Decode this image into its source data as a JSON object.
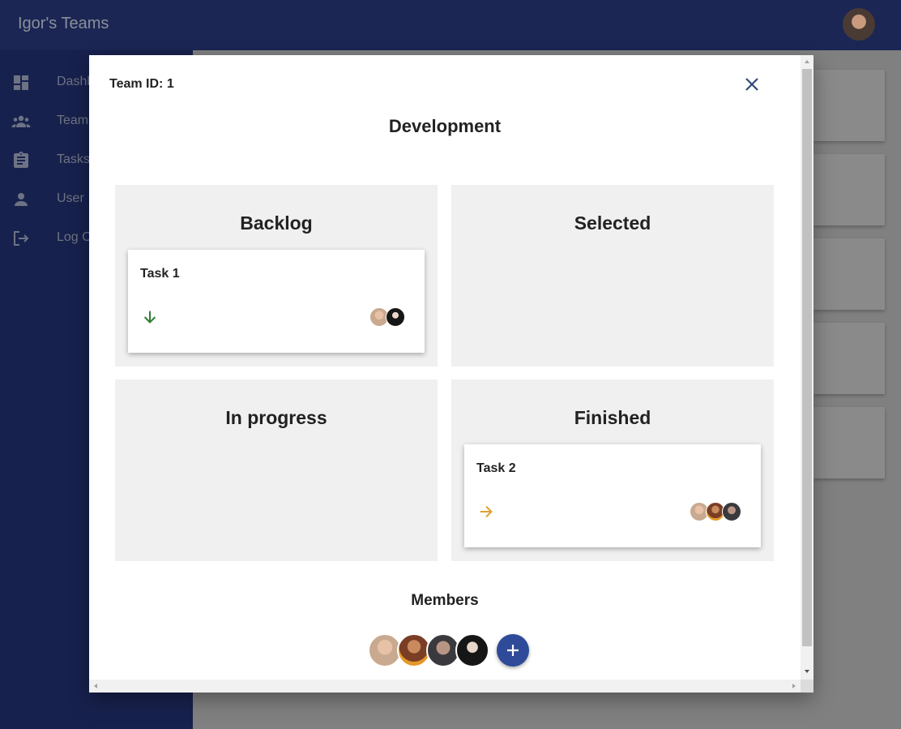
{
  "app": {
    "title": "Igor's Teams"
  },
  "sidebar": {
    "items": [
      {
        "label": "Dashboard",
        "icon": "dashboard-icon"
      },
      {
        "label": "Teams",
        "icon": "people-icon"
      },
      {
        "label": "Tasks",
        "icon": "clipboard-icon"
      },
      {
        "label": "User",
        "icon": "person-icon"
      },
      {
        "label": "Log Out",
        "icon": "logout-icon"
      }
    ]
  },
  "modal": {
    "team_id": "Team ID: 1",
    "team_name": "Development",
    "columns": [
      {
        "title": "Backlog",
        "tasks": [
          {
            "title": "Task 1",
            "priority_icon": "arrow-down-icon",
            "priority_color": "#2e7d32",
            "assignees": [
              "av-a",
              "av-d"
            ]
          }
        ]
      },
      {
        "title": "Selected",
        "tasks": []
      },
      {
        "title": "In progress",
        "tasks": []
      },
      {
        "title": "Finished",
        "tasks": [
          {
            "title": "Task 2",
            "priority_icon": "arrow-right-icon",
            "priority_color": "#e0a030",
            "assignees": [
              "av-a",
              "av-b",
              "av-c"
            ]
          }
        ]
      }
    ],
    "members_title": "Members",
    "members": [
      "av-a",
      "av-b",
      "av-c",
      "av-d"
    ],
    "add_member_icon": "plus-icon"
  },
  "colors": {
    "topbar": "#1b2654",
    "sidebar": "#17214d",
    "accent": "#2f4a99"
  }
}
